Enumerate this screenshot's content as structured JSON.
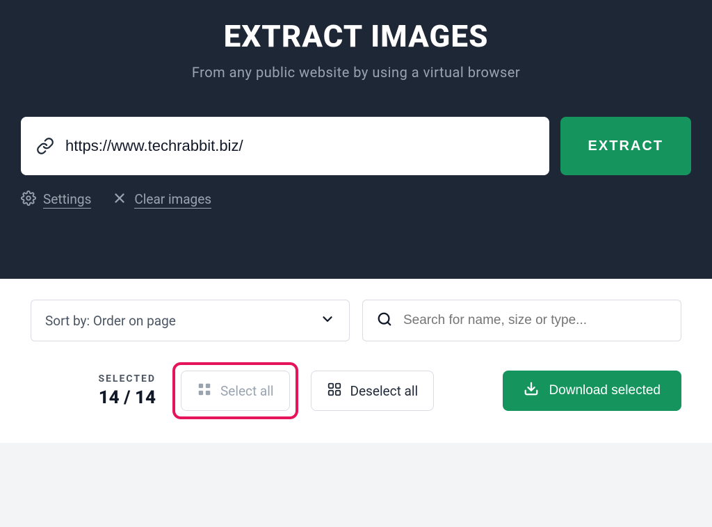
{
  "hero": {
    "title": "EXTRACT IMAGES",
    "subtitle": "From any public website by using a virtual browser",
    "url_value": "https://www.techrabbit.biz/",
    "extract_label": "EXTRACT",
    "settings_label": "Settings",
    "clear_label": "Clear images"
  },
  "filters": {
    "sort_label": "Sort by: Order on page",
    "search_placeholder": "Search for name, size or type..."
  },
  "controls": {
    "selected_label": "SELECTED",
    "selected_count": "14 / 14",
    "select_all_label": "Select all",
    "deselect_all_label": "Deselect all",
    "download_label": "Download selected"
  }
}
